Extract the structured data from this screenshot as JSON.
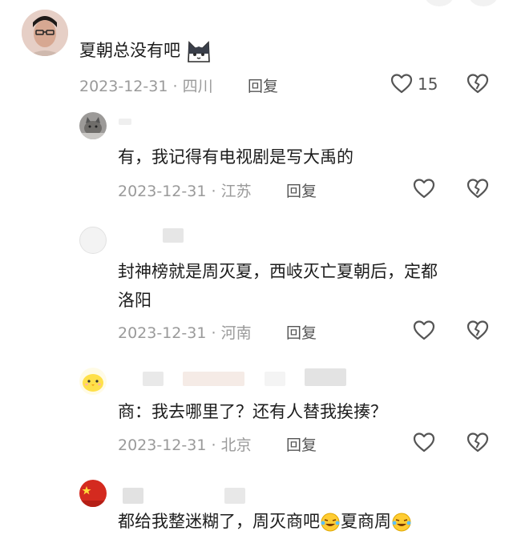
{
  "comments": [
    {
      "text": "夏朝总没有吧",
      "date": "2023-12-31",
      "location": "四川",
      "reply_label": "回复",
      "likes": "15"
    },
    {
      "text": "有，我记得有电视剧是写大禹的",
      "date": "2023-12-31",
      "location": "江苏",
      "reply_label": "回复"
    },
    {
      "text_line1": "封神榜就是周灭夏，西岐灭亡夏朝后，定都",
      "text_line2": "洛阳",
      "date": "2023-12-31",
      "location": "河南",
      "reply_label": "回复"
    },
    {
      "text": "商：我去哪里了？还有人替我挨揍？",
      "date": "2023-12-31",
      "location": "北京",
      "reply_label": "回复"
    },
    {
      "text_a": "都给我整迷糊了，周灭商吧",
      "text_b": "夏商周"
    }
  ],
  "meta_separator": "·",
  "icons": {
    "like": "heart-outline-icon",
    "dislike": "broken-heart-icon",
    "emoji_cat": "cat-face-emoji-icon",
    "emoji_laugh": "laughing-crying-emoji-icon"
  },
  "colors": {
    "text": "#1c1c1c",
    "meta": "#9a9a9a",
    "icon": "#555555"
  }
}
